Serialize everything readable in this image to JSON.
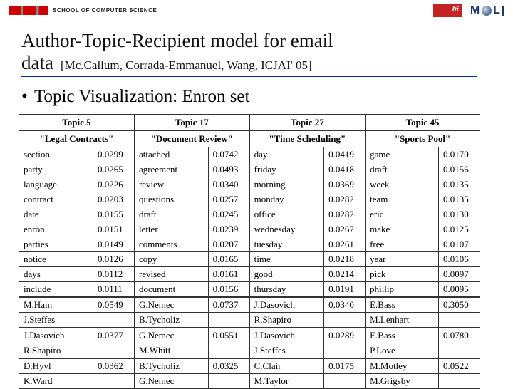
{
  "header": {
    "scs_text": "SCHOOL OF COMPUTER SCIENCE"
  },
  "title": {
    "line1": "Author-Topic-Recipient model for email",
    "line2_word": "data",
    "citation": "[Mc.Callum, Corrada-Emmanuel, Wang, ICJAI' 05]"
  },
  "bullet": "Topic Visualization: Enron set",
  "topics": [
    {
      "num": "Topic 5",
      "name": "\"Legal Contracts\"",
      "words": [
        [
          "section",
          "0.0299"
        ],
        [
          "party",
          "0.0265"
        ],
        [
          "language",
          "0.0226"
        ],
        [
          "contract",
          "0.0203"
        ],
        [
          "date",
          "0.0155"
        ],
        [
          "enron",
          "0.0151"
        ],
        [
          "parties",
          "0.0149"
        ],
        [
          "notice",
          "0.0126"
        ],
        [
          "days",
          "0.0112"
        ],
        [
          "include",
          "0.0111"
        ]
      ],
      "people1": [
        [
          "M.Hain",
          "0.0549"
        ],
        [
          "J.Steffes",
          ""
        ]
      ],
      "people2": [
        [
          "J.Dasovich",
          "0.0377"
        ],
        [
          "R.Shapiro",
          ""
        ]
      ],
      "people3": [
        [
          "D.Hyvl",
          "0.0362"
        ],
        [
          "K.Ward",
          ""
        ]
      ]
    },
    {
      "num": "Topic 17",
      "name": "\"Document Review\"",
      "words": [
        [
          "attached",
          "0.0742"
        ],
        [
          "agreement",
          "0.0493"
        ],
        [
          "review",
          "0.0340"
        ],
        [
          "questions",
          "0.0257"
        ],
        [
          "draft",
          "0.0245"
        ],
        [
          "letter",
          "0.0239"
        ],
        [
          "comments",
          "0.0207"
        ],
        [
          "copy",
          "0.0165"
        ],
        [
          "revised",
          "0.0161"
        ],
        [
          "document",
          "0.0156"
        ]
      ],
      "people1": [
        [
          "G.Nemec",
          "0.0737"
        ],
        [
          "B.Tycholiz",
          ""
        ]
      ],
      "people2": [
        [
          "G.Nemec",
          "0.0551"
        ],
        [
          "M.Whitt",
          ""
        ]
      ],
      "people3": [
        [
          "B.Tycholiz",
          "0.0325"
        ],
        [
          "G.Nemec",
          ""
        ]
      ]
    },
    {
      "num": "Topic 27",
      "name": "\"Time Scheduling\"",
      "words": [
        [
          "day",
          "0.0419"
        ],
        [
          "friday",
          "0.0418"
        ],
        [
          "morning",
          "0.0369"
        ],
        [
          "monday",
          "0.0282"
        ],
        [
          "office",
          "0.0282"
        ],
        [
          "wednesday",
          "0.0267"
        ],
        [
          "tuesday",
          "0.0261"
        ],
        [
          "time",
          "0.0218"
        ],
        [
          "good",
          "0.0214"
        ],
        [
          "thursday",
          "0.0191"
        ]
      ],
      "people1": [
        [
          "J.Dasovich",
          "0.0340"
        ],
        [
          "R.Shapiro",
          ""
        ]
      ],
      "people2": [
        [
          "J.Dasovich",
          "0.0289"
        ],
        [
          "J.Steffes",
          ""
        ]
      ],
      "people3": [
        [
          "C.Clair",
          "0.0175"
        ],
        [
          "M.Taylor",
          ""
        ]
      ]
    },
    {
      "num": "Topic 45",
      "name": "\"Sports Pool\"",
      "words": [
        [
          "game",
          "0.0170"
        ],
        [
          "draft",
          "0.0156"
        ],
        [
          "week",
          "0.0135"
        ],
        [
          "team",
          "0.0135"
        ],
        [
          "eric",
          "0.0130"
        ],
        [
          "make",
          "0.0125"
        ],
        [
          "free",
          "0.0107"
        ],
        [
          "year",
          "0.0106"
        ],
        [
          "pick",
          "0.0097"
        ],
        [
          "phillip",
          "0.0095"
        ]
      ],
      "people1": [
        [
          "E.Bass",
          "0.3050"
        ],
        [
          "M.Lenhart",
          ""
        ]
      ],
      "people2": [
        [
          "E.Bass",
          "0.0780"
        ],
        [
          "P.Love",
          ""
        ]
      ],
      "people3": [
        [
          "M.Motley",
          "0.0522"
        ],
        [
          "M.Grigsby",
          ""
        ]
      ]
    }
  ]
}
